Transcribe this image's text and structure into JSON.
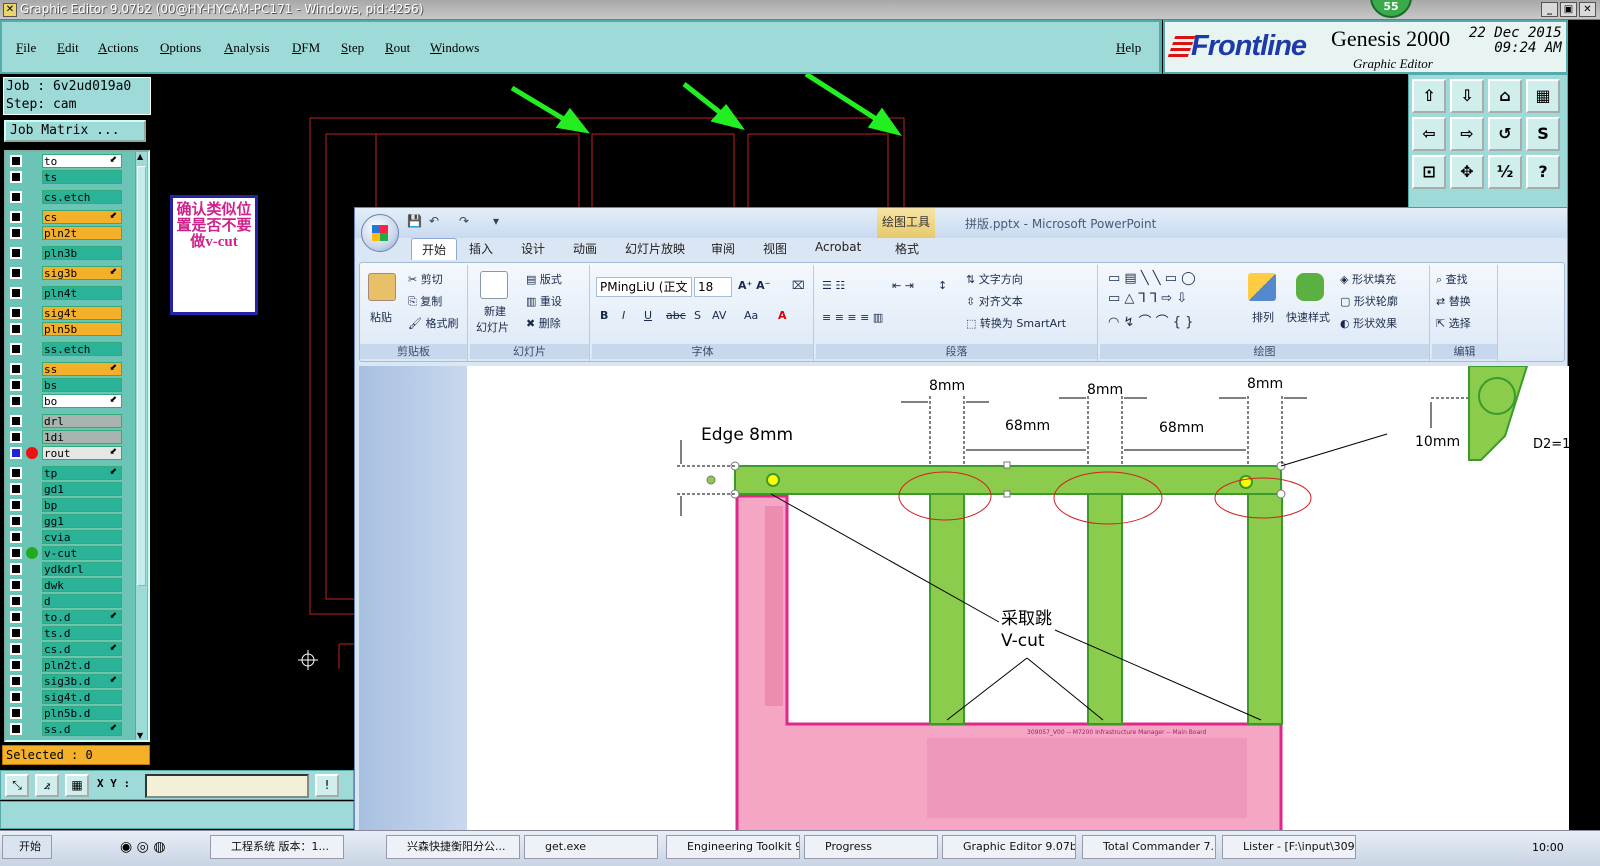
{
  "window": {
    "title": "Graphic Editor 9.07b2 (00@HY-HYCAM-PC171 - Windows, pid:4256)",
    "badge": "55"
  },
  "menu": [
    "File",
    "Edit",
    "Actions",
    "Options",
    "Analysis",
    "DFM",
    "Step",
    "Rout",
    "Windows"
  ],
  "help": "Help",
  "brand": {
    "logo": "Frontline",
    "product": "Genesis 2000",
    "subtitle": "Graphic Editor",
    "date": "22 Dec 2015",
    "time": "09:24 AM"
  },
  "job": {
    "job": "Job : 6v2ud019a0",
    "step": "Step: cam",
    "matrix": "Job Matrix ..."
  },
  "layers": [
    {
      "name": "to",
      "color": "white",
      "arrow": true
    },
    {
      "name": "ts",
      "color": "teal"
    },
    {
      "name": "cs.etch",
      "color": "teal"
    },
    {
      "name": "cs",
      "color": "orange",
      "arrow": true
    },
    {
      "name": "pln2t",
      "color": "orange"
    },
    {
      "name": "pln3b",
      "color": "teal"
    },
    {
      "name": "sig3b",
      "color": "orange",
      "arrow": true
    },
    {
      "name": "pln4t",
      "color": "teal"
    },
    {
      "name": "sig4t",
      "color": "orange"
    },
    {
      "name": "pln5b",
      "color": "orange"
    },
    {
      "name": "ss.etch",
      "color": "teal"
    },
    {
      "name": "ss",
      "color": "orange",
      "arrow": true
    },
    {
      "name": "bs",
      "color": "teal"
    },
    {
      "name": "bo",
      "color": "white",
      "arrow": true
    },
    {
      "name": "drl",
      "color": "gray"
    },
    {
      "name": "1di",
      "color": "gray"
    },
    {
      "name": "rout",
      "color": "sel",
      "work": true,
      "arrow": true
    },
    {
      "name": "tp",
      "color": "teal",
      "arrow": true
    },
    {
      "name": "gd1",
      "color": "teal"
    },
    {
      "name": "bp",
      "color": "teal"
    },
    {
      "name": "gg1",
      "color": "teal"
    },
    {
      "name": "cvia",
      "color": "teal"
    },
    {
      "name": "v-cut",
      "color": "teal",
      "affected": true
    },
    {
      "name": "ydkdrl",
      "color": "teal"
    },
    {
      "name": "dwk",
      "color": "teal"
    },
    {
      "name": "d",
      "color": "teal"
    },
    {
      "name": "to.d",
      "color": "teal",
      "arrow": true
    },
    {
      "name": "ts.d",
      "color": "teal"
    },
    {
      "name": "cs.d",
      "color": "teal",
      "arrow": true
    },
    {
      "name": "pln2t.d",
      "color": "teal"
    },
    {
      "name": "sig3b.d",
      "color": "teal",
      "arrow": true
    },
    {
      "name": "sig4t.d",
      "color": "teal"
    },
    {
      "name": "pln5b.d",
      "color": "teal"
    },
    {
      "name": "ss.d",
      "color": "teal",
      "arrow": true
    }
  ],
  "layer_colors": {
    "white": "#ffffff",
    "teal": "#2bb39a",
    "orange": "#f4b028",
    "gray": "#a8b4b0",
    "sel": "#e6e6e6"
  },
  "selected": "Selected : 0",
  "xy_label": "X Y :",
  "xy_value": "",
  "note": "确认类似位置是否不要做v-cut",
  "ppt": {
    "context_tab": "绘图工具",
    "doc_title": "拼版.pptx - Microsoft PowerPoint",
    "tabs": [
      "开始",
      "插入",
      "设计",
      "动画",
      "幻灯片放映",
      "审阅",
      "视图",
      "Acrobat",
      "格式"
    ],
    "clipboard": {
      "paste": "粘贴",
      "cut": "剪切",
      "copy": "复制",
      "format_painter": "格式刷",
      "label": "剪贴板"
    },
    "slides": {
      "new": "新建",
      "new2": "幻灯片",
      "layout": "版式",
      "reset": "重设",
      "delete": "删除",
      "label": "幻灯片"
    },
    "font": {
      "name": "PMingLiU (正文",
      "size": "18",
      "label": "字体"
    },
    "paragraph": {
      "direction": "文字方向",
      "align_text": "对齐文本",
      "smartart": "转换为 SmartArt",
      "label": "段落"
    },
    "drawing": {
      "arrange": "排列",
      "quick_styles": "快速样式",
      "fill": "形状填充",
      "outline": "形状轮廓",
      "effects": "形状效果",
      "label": "绘图"
    },
    "editing": {
      "find": "查找",
      "replace": "替换",
      "select": "选择",
      "label": "编辑"
    }
  },
  "slide": {
    "edge": "Edge 8mm",
    "dims": [
      "8mm",
      "8mm",
      "8mm",
      "68mm",
      "68mm",
      "10mm",
      "D2=1"
    ],
    "callout1": "采取跳",
    "callout2": "V-cut",
    "pcb_text": "309057_V00 -- M7200 Infrastructure Manager -- Main Board"
  },
  "taskbar": [
    "开始",
    "工程系统  版本：1...",
    "兴森快捷衡阳分公...",
    "get.exe",
    "Engineering Toolkit 9...",
    "Progress",
    "Graphic Editor 9.07b...",
    "Total Commander 7....",
    "Lister - [F:\\input\\309....",
    "10:00"
  ]
}
